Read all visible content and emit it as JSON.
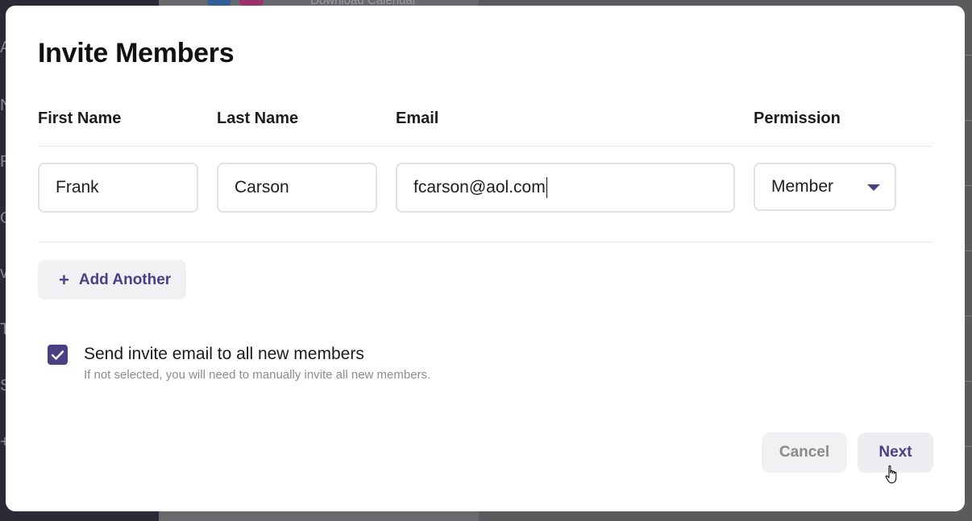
{
  "modal": {
    "title": "Invite Members"
  },
  "columns": {
    "first_name": "First Name",
    "last_name": "Last Name",
    "email": "Email",
    "permission": "Permission"
  },
  "row": {
    "first_name": "Frank",
    "last_name": "Carson",
    "email": "fcarson@aol.com",
    "permission": "Member"
  },
  "add_another": {
    "icon": "plus-icon",
    "label": "Add Another"
  },
  "send_invite": {
    "checked": true,
    "label": "Send invite email to all new members",
    "help": "If not selected, you will need to manually invite all new members."
  },
  "footer": {
    "cancel_label": "Cancel",
    "next_label": "Next"
  },
  "background": {
    "top_text": "Download Calendar"
  },
  "colors": {
    "accent": "#4b3f86",
    "overlay": "#5d5d60",
    "button_bg": "#f1f1f3"
  }
}
